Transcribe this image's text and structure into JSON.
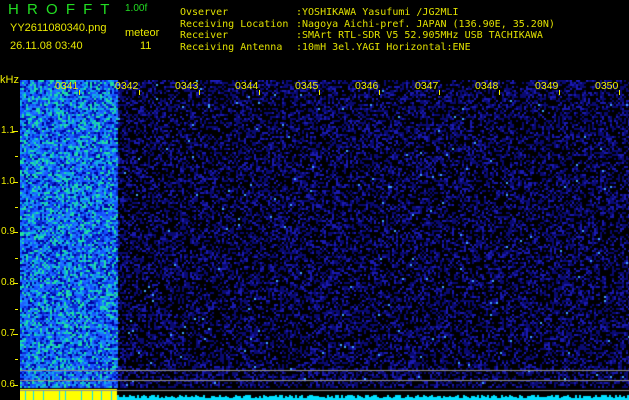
{
  "app": {
    "name": "H R O F F T",
    "version": "1.00f"
  },
  "file": {
    "name": "YY2611080340.png",
    "datetime": "26.11.08 03:40"
  },
  "meteor": {
    "label": "meteor",
    "count": "11"
  },
  "info": {
    "labels": [
      "Ovserver",
      "Receiving Location",
      "Receiver",
      "Receiving Antenna"
    ],
    "values": [
      ":YOSHIKAWA Yasufumi /JG2MLI",
      ":Nagoya Aichi-pref. JAPAN (136.90E, 35.20N)",
      ":SMArt RTL-SDR V5 52.905MHz USB TACHIKAWA",
      ":10mH 3el.YAGI Horizontal:ENE"
    ]
  },
  "chart_data": {
    "type": "heatmap",
    "ylabel": "kHz",
    "x_ticks": [
      "0341",
      "0342",
      "0343",
      "0344",
      "0345",
      "0346",
      "0347",
      "0348",
      "0349",
      "0350"
    ],
    "y_ticks": [
      "1.1",
      "1.0",
      "0.9",
      "0.8",
      "0.7",
      "0.6"
    ],
    "ylim": [
      0.57,
      1.2
    ],
    "colors": {
      "background": "#000000",
      "noise_low": "#0a0a80",
      "noise_high": "#00c0ff",
      "signal": "#ffff00",
      "accent": "#22dd22"
    }
  }
}
